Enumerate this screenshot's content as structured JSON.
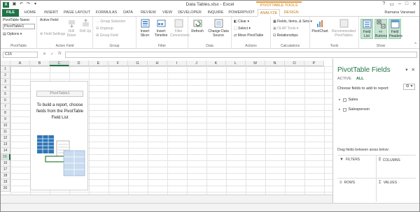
{
  "window": {
    "title": "Data Tables.xlsx - Excel",
    "context_group": "PIVOTTABLE TOOLS"
  },
  "user": "Ramana Varanasi",
  "tabs": [
    "FILE",
    "HOME",
    "INSERT",
    "PAGE LAYOUT",
    "FORMULAS",
    "DATA",
    "REVIEW",
    "VIEW",
    "DEVELOPER",
    "INQUIRE",
    "POWERPIVOT",
    "ANALYZE",
    "DESIGN"
  ],
  "ribbon": {
    "pivottable": {
      "name_label": "PivotTable Name:",
      "name_value": "PivotTable1",
      "options": "Options",
      "group": "PivotTable"
    },
    "active_field": {
      "label": "Active Field:",
      "field_settings": "Field Settings",
      "drill_down": "Drill Down",
      "drill_up": "Drill Up",
      "group": "Active Field"
    },
    "group_grp": {
      "group_selection": "Group Selection",
      "ungroup": "Ungroup",
      "group_field": "Group Field",
      "group": "Group"
    },
    "filter": {
      "insert_slicer": "Insert Slicer",
      "insert_timeline": "Insert Timeline",
      "filter_connections": "Filter Connections",
      "group": "Filter"
    },
    "data": {
      "refresh": "Refresh",
      "change_source": "Change Data Source",
      "group": "Data"
    },
    "actions": {
      "clear": "Clear",
      "select": "Select",
      "move": "Move PivotTable",
      "group": "Actions"
    },
    "calculations": {
      "fields_items": "Fields, Items, & Sets",
      "olap": "OLAP Tools",
      "relationships": "Relationships",
      "group": "Calculations"
    },
    "tools": {
      "pivotchart": "PivotChart",
      "recommended": "Recommended PivotTables",
      "group": "Tools"
    },
    "show": {
      "field_list": "Field List",
      "buttons": "+/- Buttons",
      "field_headers": "Field Headers",
      "group": "Show"
    }
  },
  "formula_bar": {
    "name_box": "C15",
    "fx": "fx"
  },
  "columns": [
    "A",
    "B",
    "C",
    "D",
    "E",
    "F",
    "G",
    "H",
    "I",
    "J",
    "K",
    "L",
    "M",
    "N",
    "O",
    "P"
  ],
  "rows": [
    "1",
    "2",
    "3",
    "4",
    "5",
    "6",
    "7",
    "8",
    "9",
    "10",
    "11",
    "12",
    "13",
    "14",
    "15",
    "16",
    "17",
    "18",
    "19",
    "20"
  ],
  "pivot_placeholder": {
    "name": "PivotTable1",
    "instruction_lines": [
      "To build a report, choose",
      "fields from the PivotTable",
      "Field List"
    ]
  },
  "field_pane": {
    "title": "PivotTable Fields",
    "tabs": [
      "ACTIVE",
      "ALL"
    ],
    "choose_label": "Choose fields to add to report:",
    "fields": [
      "Sales",
      "Salesperson"
    ],
    "drag_label": "Drag fields between areas below:",
    "areas": [
      "FILTERS",
      "COLUMNS",
      "ROWS",
      "VALUES"
    ]
  }
}
